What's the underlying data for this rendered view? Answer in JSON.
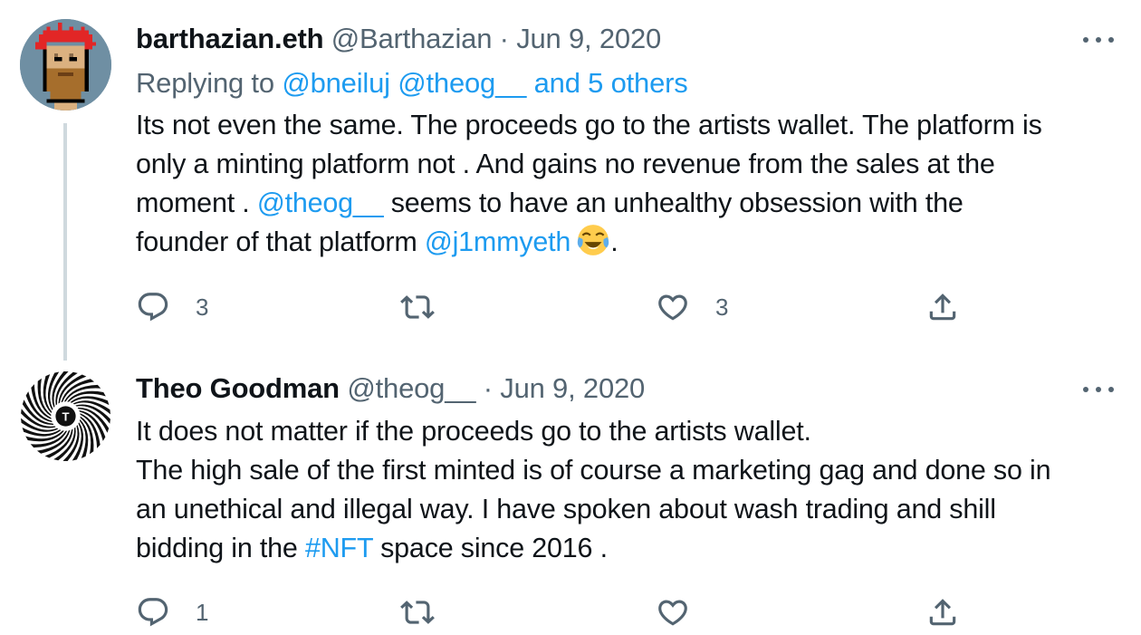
{
  "tweets": [
    {
      "display_name": "barthazian.eth",
      "handle": "@Barthazian",
      "separator": "·",
      "date": "Jun 9, 2020",
      "replying_prefix": "Replying to",
      "replying_to": [
        "@bneiluj",
        "@theog__",
        "and 5 others"
      ],
      "body_lines": [
        {
          "text": "Its not even the same. The proceeds go to the artists wallet. The platform is"
        },
        {
          "text": "only a minting platform not . And gains no revenue from the sales at the"
        },
        {
          "pre": "moment . ",
          "mention": "@theog__",
          "post": " seems to have an unhealthy obsession with the"
        },
        {
          "pre": "founder of that platform ",
          "mention": "@j1mmyeth",
          "emoji": "face-with-tears-of-joy-emoji",
          "post": "."
        }
      ],
      "actions": {
        "reply_count": "3",
        "retweet_count": "",
        "like_count": "3"
      },
      "avatar": "pixel-punk-avatar"
    },
    {
      "display_name": "Theo Goodman",
      "handle": "@theog__",
      "separator": "·",
      "date": "Jun 9, 2020",
      "body_lines": [
        {
          "text": "It does not matter if the proceeds go to the artists wallet."
        },
        {
          "text": "The high sale of the first minted is of course a marketing gag and done so in"
        },
        {
          "text": "an unethical and illegal way. I have spoken about wash trading and shill"
        },
        {
          "pre": "bidding in the ",
          "hashtag": "#NFT",
          "post": " space since 2016 ."
        }
      ],
      "actions": {
        "reply_count": "1",
        "retweet_count": "",
        "like_count": ""
      },
      "avatar": "spiral-t-avatar",
      "avatar_letter": "T"
    }
  ],
  "icons": {
    "reply": "reply-icon",
    "retweet": "retweet-icon",
    "like": "heart-icon",
    "share": "share-icon",
    "more": "more-icon"
  },
  "colors": {
    "text": "#0f1419",
    "secondary": "#536471",
    "link": "#1d9bf0",
    "thread_line": "#cfd9de"
  }
}
